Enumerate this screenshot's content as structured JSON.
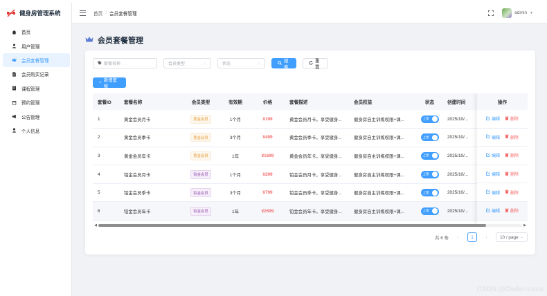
{
  "app": {
    "title": "健身房管理系统"
  },
  "sidebar": {
    "items": [
      {
        "label": "首页",
        "icon": "home-icon",
        "active": false
      },
      {
        "label": "用户管理",
        "icon": "user-icon",
        "active": false
      },
      {
        "label": "会员套餐管理",
        "icon": "crown-icon",
        "active": true
      },
      {
        "label": "会员购买记录",
        "icon": "document-icon",
        "active": false
      },
      {
        "label": "课程管理",
        "icon": "book-icon",
        "active": false
      },
      {
        "label": "预约管理",
        "icon": "calendar-icon",
        "active": false
      },
      {
        "label": "公告管理",
        "icon": "megaphone-icon",
        "active": false
      },
      {
        "label": "个人信息",
        "icon": "person-icon",
        "active": false
      }
    ]
  },
  "header": {
    "breadcrumb": [
      "首页",
      "会员套餐管理"
    ],
    "separator": "/",
    "username": "admin"
  },
  "page": {
    "title": "会员套餐管理"
  },
  "filters": {
    "name_placeholder": "套餐名称",
    "type_placeholder": "会员类型",
    "status_placeholder": "状态",
    "search_label": "搜索",
    "reset_label": "重置"
  },
  "toolbar": {
    "add_label": "新增套餐"
  },
  "table": {
    "columns": [
      "套餐ID",
      "套餐名称",
      "会员类型",
      "有效期",
      "价格",
      "套餐描述",
      "会员权益",
      "状态",
      "创建时间",
      "操作"
    ],
    "rows": [
      {
        "id": "1",
        "name": "黄金会员月卡",
        "type": "黄金会员",
        "type_kind": "gold",
        "period": "1个月",
        "price": "¥199",
        "desc": "黄金会员月卡，享受健身...",
        "benefit": "健身房自主训练权限+课...",
        "status": "上架",
        "created": "2025/10/..."
      },
      {
        "id": "2",
        "name": "黄金会员季卡",
        "type": "黄金会员",
        "type_kind": "gold",
        "period": "3个月",
        "price": "¥499",
        "desc": "黄金会员季卡，享受健身...",
        "benefit": "健身房自主训练权限+课...",
        "status": "上架",
        "created": "2025/10/..."
      },
      {
        "id": "3",
        "name": "黄金会员年卡",
        "type": "黄金会员",
        "type_kind": "gold",
        "period": "1年",
        "price": "¥1699",
        "desc": "黄金会员年卡，享受健身...",
        "benefit": "健身房自主训练权限+课...",
        "status": "上架",
        "created": "2025/10/..."
      },
      {
        "id": "4",
        "name": "铂金会员月卡",
        "type": "铂金会员",
        "type_kind": "plat",
        "period": "1个月",
        "price": "¥299",
        "desc": "铂金会员月卡，享受健身...",
        "benefit": "健身房自主训练权限+课...",
        "status": "上架",
        "created": "2025/10/..."
      },
      {
        "id": "5",
        "name": "铂金会员季卡",
        "type": "铂金会员",
        "type_kind": "plat",
        "period": "3个月",
        "price": "¥799",
        "desc": "铂金会员季卡，享受健身...",
        "benefit": "健身房自主训练权限+课...",
        "status": "上架",
        "created": "2025/10/..."
      },
      {
        "id": "6",
        "name": "铂金会员年卡",
        "type": "铂金会员",
        "type_kind": "plat",
        "period": "1年",
        "price": "¥2699",
        "desc": "铂金会员年卡，享受健身...",
        "benefit": "健身房自主训练权限+课...",
        "status": "上架",
        "created": "2025/10/..."
      }
    ],
    "edit_label": "编辑",
    "delete_label": "删除"
  },
  "pagination": {
    "total_text": "共 6 条",
    "current_page": "1",
    "page_size": "10 / page"
  },
  "watermark": "CSDN @Coder-coco",
  "colors": {
    "primary": "#409eff",
    "danger": "#f56c6c",
    "gold": "#e6a23c",
    "platinum": "#9b59b6"
  }
}
